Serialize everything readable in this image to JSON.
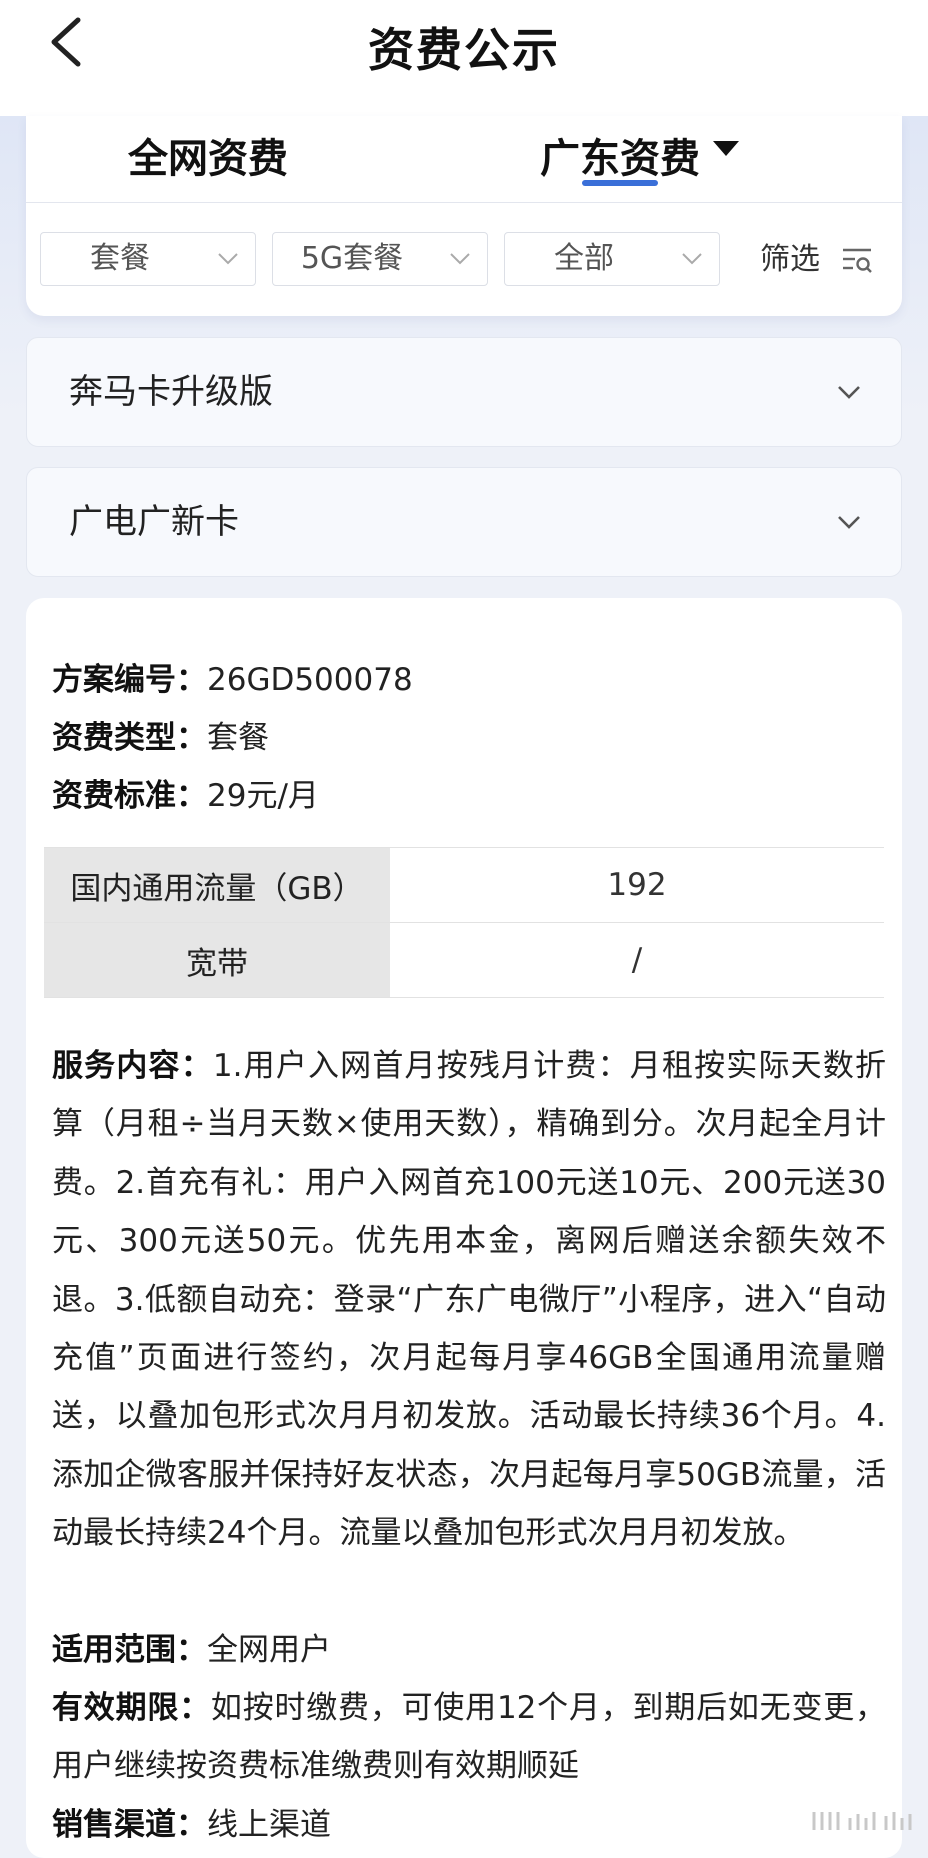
{
  "header": {
    "title": "资费公示"
  },
  "tabs": [
    {
      "label": "全网资费"
    },
    {
      "label": "广东资费"
    }
  ],
  "filters": {
    "selects": [
      {
        "value": "套餐"
      },
      {
        "value": "5G套餐"
      },
      {
        "value": "全部"
      }
    ],
    "filter_label": "筛选"
  },
  "accordions": [
    {
      "label": "奔马卡升级版"
    },
    {
      "label": "广电广新卡"
    }
  ],
  "detail": {
    "plan_no": {
      "key": "方案编号：",
      "value": "26GD500078"
    },
    "fee_type": {
      "key": "资费类型：",
      "value": "套餐"
    },
    "fee_standard": {
      "key": "资费标准：",
      "value": "29元/月"
    },
    "table": [
      {
        "name": "国内通用流量（GB）",
        "value": "192"
      },
      {
        "name": "宽带",
        "value": "/"
      }
    ],
    "service": {
      "key": "服务内容：",
      "value": "1.用户入网首月按残月计费：月租按实际天数折算（月租÷当月天数×使用天数），精确到分。次月起全月计费。2.首充有礼：用户入网首充100元送10元、200元送30元、300元送50元。优先用本金，离网后赠送余额失效不退。3.低额自动充：登录“广东广电微厅”小程序，进入“自动充值”页面进行签约，次月起每月享46GB全国通用流量赠送，以叠加包形式次月月初发放。活动最长持续36个月。4.添加企微客服并保持好友状态，次月起每月享50GB流量，活动最长持续24个月。流量以叠加包形式次月月初发放。"
    },
    "scope": {
      "key": "适用范围：",
      "value": "全网用户"
    },
    "validity": {
      "key": "有效期限：",
      "value": "如按时缴费，可使用12个月，到期后如无变更，用户继续按资费标准缴费则有效期顺延"
    },
    "channel": {
      "key": "销售渠道：",
      "value": "线上渠道"
    }
  }
}
